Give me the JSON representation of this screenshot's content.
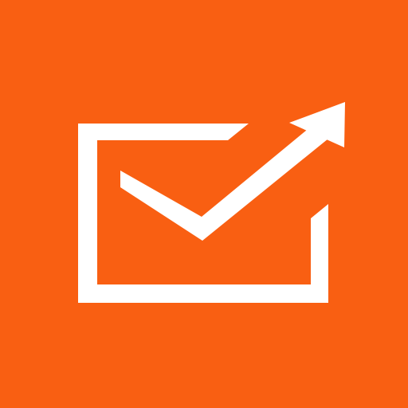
{
  "icon": {
    "name": "envelope-send-arrow-icon",
    "background_color": "#f95f12",
    "foreground_color": "#ffffff"
  }
}
